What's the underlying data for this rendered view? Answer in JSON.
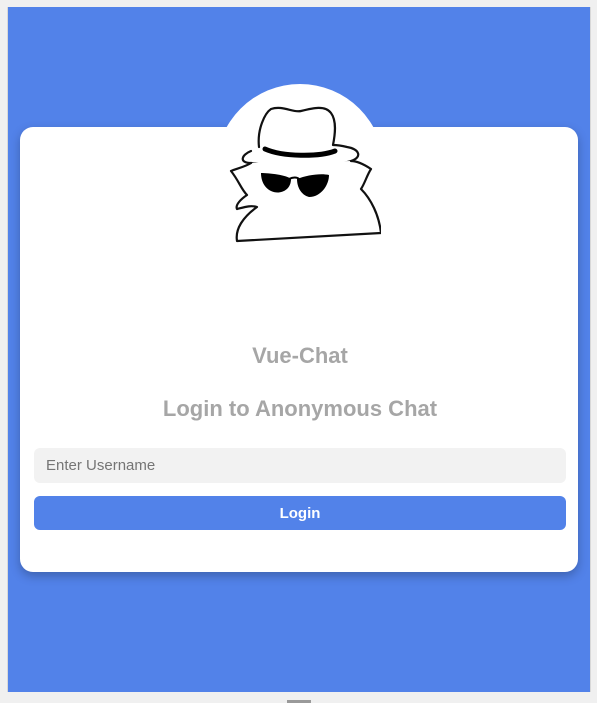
{
  "app": {
    "title": "Vue-Chat",
    "subtitle": "Login to Anonymous Chat"
  },
  "login_form": {
    "username_placeholder": "Enter Username",
    "username_value": "",
    "submit_label": "Login"
  },
  "colors": {
    "background": "#5282e9",
    "card": "#ffffff",
    "heading_text": "#a6a6a6",
    "button": "#5282e9",
    "input_background": "#f2f2f2"
  },
  "icons": {
    "avatar": "incognito-spy-icon"
  }
}
